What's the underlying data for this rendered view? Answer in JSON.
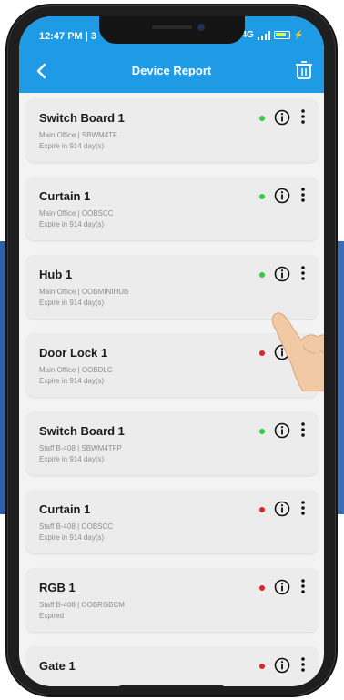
{
  "status_bar": {
    "time": "12:47 PM | 3",
    "network": "4G"
  },
  "header": {
    "title": "Device Report",
    "back_icon": "back-arrow-icon",
    "action_icon": "trash-icon"
  },
  "colors": {
    "app_bar": "#1f9be6",
    "online": "#2ecc40",
    "offline": "#e0222a"
  },
  "devices": [
    {
      "name": "Switch Board 1",
      "location": "Main Office | SBWM4TF",
      "expiry": "Expire in 914 day(s)",
      "status": "online"
    },
    {
      "name": "Curtain 1",
      "location": "Main Office | OOBSCC",
      "expiry": "Expire in 914 day(s)",
      "status": "online"
    },
    {
      "name": "Hub 1",
      "location": "Main Office | OOBMINIHUB",
      "expiry": "Expire in 914 day(s)",
      "status": "online"
    },
    {
      "name": "Door Lock 1",
      "location": "Main Office | OOBDLC",
      "expiry": "Expire in 914 day(s)",
      "status": "offline"
    },
    {
      "name": "Switch Board 1",
      "location": "Staff B-408 | SBWM4TFP",
      "expiry": "Expire in 914 day(s)",
      "status": "online"
    },
    {
      "name": "Curtain 1",
      "location": "Staff B-408 | OOBSCC",
      "expiry": "Expire in 914 day(s)",
      "status": "offline"
    },
    {
      "name": "RGB 1",
      "location": "Staff B-408 | OOBRGBCM",
      "expiry": "Expired",
      "status": "offline"
    },
    {
      "name": "Gate 1",
      "location": "",
      "expiry": "",
      "status": "offline"
    }
  ]
}
